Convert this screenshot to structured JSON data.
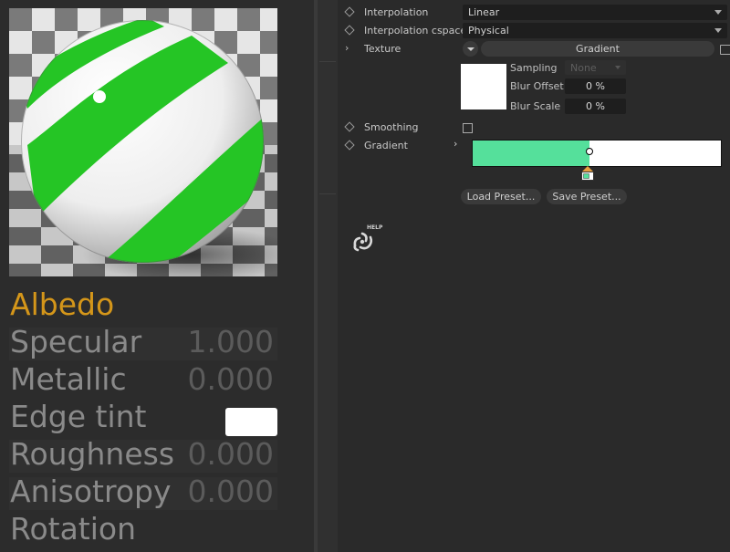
{
  "material": {
    "rows": [
      {
        "label": "Albedo",
        "value": ""
      },
      {
        "label": "Specular",
        "value": "1.000"
      },
      {
        "label": "Metallic",
        "value": "0.000"
      },
      {
        "label": "Edge tint",
        "value": ""
      },
      {
        "label": "Roughness",
        "value": "0.000"
      },
      {
        "label": "Anisotropy",
        "value": "0.000"
      },
      {
        "label": "Rotation",
        "value": ""
      }
    ],
    "accent_color": "#d4961a",
    "edge_tint_color": "#ffffff"
  },
  "attributes": {
    "interpolation": {
      "label": "Interpolation",
      "value": "Linear"
    },
    "interpolation_cspace": {
      "label": "Interpolation cspace",
      "value": "Physical"
    },
    "texture": {
      "label": "Texture",
      "button": "Gradient"
    },
    "sampling": {
      "label": "Sampling",
      "value": "None"
    },
    "blur_offset": {
      "label": "Blur Offset",
      "value": "0 %"
    },
    "blur_scale": {
      "label": "Blur Scale",
      "value": "0 %"
    },
    "smoothing": {
      "label": "Smoothing",
      "checked": false
    },
    "gradient": {
      "label": "Gradient",
      "color_stop": "#55e09b",
      "stop_position": 0.47
    },
    "load_preset": "Load Preset...",
    "save_preset": "Save Preset...",
    "help_label": "HELP"
  }
}
